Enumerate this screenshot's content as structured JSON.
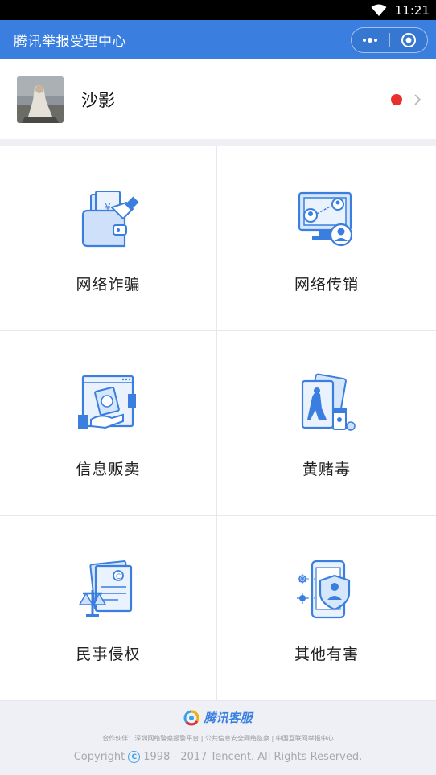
{
  "status_bar": {
    "time": "11:21"
  },
  "nav": {
    "title": "腾讯举报受理中心"
  },
  "profile": {
    "name": "沙影"
  },
  "categories": [
    {
      "label": "网络诈骗",
      "icon": "wallet-money-icon"
    },
    {
      "label": "网络传销",
      "icon": "network-users-icon"
    },
    {
      "label": "信息贩卖",
      "icon": "money-hand-icon"
    },
    {
      "label": "黄赌毒",
      "icon": "cards-pills-icon"
    },
    {
      "label": "民事侵权",
      "icon": "scale-document-icon"
    },
    {
      "label": "其他有害",
      "icon": "phone-shield-icon"
    }
  ],
  "footer": {
    "brand": "腾讯客服",
    "partners": "合作伙伴：深圳网络警察报警平台 | 公共信息安全网络监察 | 中国互联网举报中心",
    "copyright": "Copyright",
    "copyright_years": "1998 - 2017 Tencent. All Rights Reserved.",
    "copyright_mark": "C"
  },
  "colors": {
    "accent": "#3a7fe0",
    "notification": "#e8312f"
  }
}
